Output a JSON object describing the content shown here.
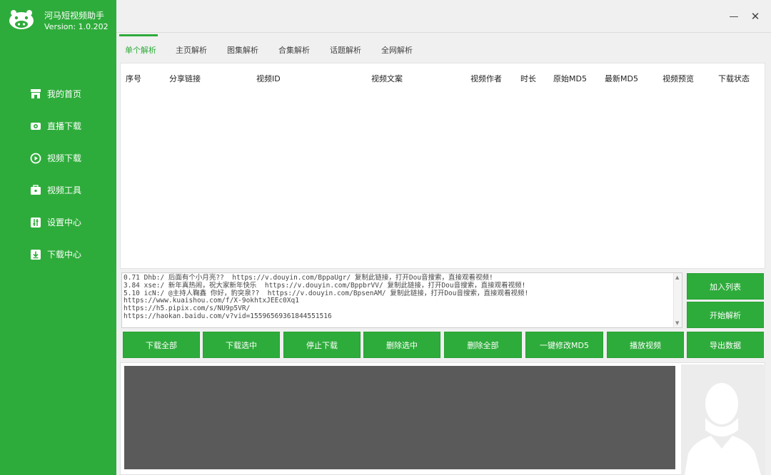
{
  "app": {
    "title": "河马短视频助手",
    "version": "Version: 1.0.202",
    "brand_color": "#2eac3b"
  },
  "sidebar": {
    "items": [
      {
        "label": "我的首页",
        "icon": "store-icon"
      },
      {
        "label": "直播下载",
        "icon": "camera-icon"
      },
      {
        "label": "视频下载",
        "icon": "play-icon"
      },
      {
        "label": "视频工具",
        "icon": "toolbox-icon"
      },
      {
        "label": "设置中心",
        "icon": "sliders-icon"
      },
      {
        "label": "下载中心",
        "icon": "download-icon"
      }
    ]
  },
  "window": {
    "minimize": "—",
    "close": "✕"
  },
  "tabs": [
    {
      "label": "单个解析",
      "active": true
    },
    {
      "label": "主页解析",
      "active": false
    },
    {
      "label": "图集解析",
      "active": false
    },
    {
      "label": "合集解析",
      "active": false
    },
    {
      "label": "话题解析",
      "active": false
    },
    {
      "label": "全网解析",
      "active": false
    }
  ],
  "table": {
    "columns": [
      "序号",
      "分享链接",
      "视频ID",
      "视频文案",
      "视频作者",
      "时长",
      "原始MD5",
      "最新MD5",
      "视频预览",
      "下载状态"
    ]
  },
  "links": {
    "lines": [
      "0.71 Dhb:/ 后面有个小月亮??  https://v.douyin.com/BppaUgr/ 复制此链接，打开Dou音搜索，直接观看视频!",
      "3.84 xse:/ 新年真热闹，祝大家新年快乐  https://v.douyin.com/BppbrVV/ 复制此链接，打开Dou音搜索，直接观看视频!",
      "5.10 icN:/ @主持人鞠鑫 你好，豹突泉??  https://v.douyin.com/BpsenAM/ 复制此链接，打开Dou音搜索，直接观看视频!",
      "https://www.kuaishou.com/f/X-9okhtxJEEc0Xq1",
      "https://h5.pipix.com/s/NU9p5VR/",
      "https://haokan.baidu.com/v?vid=15596569361844551516"
    ]
  },
  "side_buttons": {
    "add_to_list": "加入列表",
    "start_parse": "开始解析"
  },
  "action_buttons": [
    "下载全部",
    "下载选中",
    "停止下载",
    "删除选中",
    "删除全部",
    "一键修改MD5",
    "播放视频",
    "导出数据"
  ]
}
